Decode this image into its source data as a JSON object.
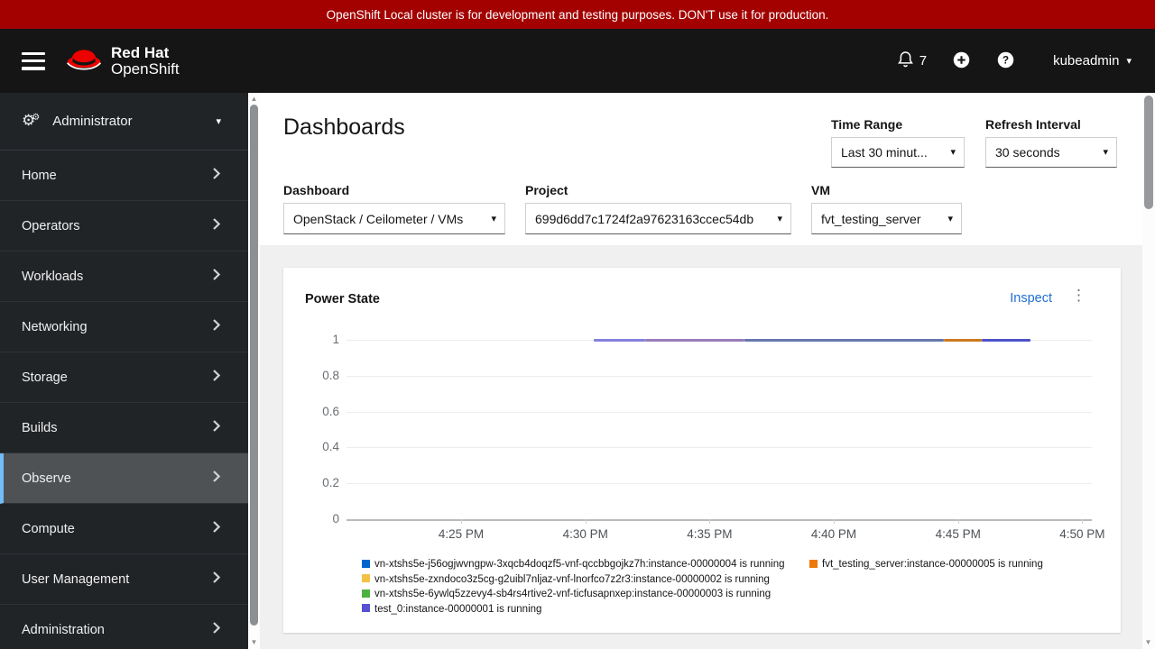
{
  "banner": {
    "text": "OpenShift Local cluster is for development and testing purposes. DON'T use it for production.",
    "background_color": "#a30000"
  },
  "masthead": {
    "brand_line1": "Red Hat",
    "brand_line2": "OpenShift",
    "notification_count": "7",
    "username": "kubeadmin"
  },
  "sidebar": {
    "perspective": "Administrator",
    "active_item_color": "#73bcf7",
    "items": [
      {
        "label": "Home",
        "active": false
      },
      {
        "label": "Operators",
        "active": false
      },
      {
        "label": "Workloads",
        "active": false
      },
      {
        "label": "Networking",
        "active": false
      },
      {
        "label": "Storage",
        "active": false
      },
      {
        "label": "Builds",
        "active": false
      },
      {
        "label": "Observe",
        "active": true
      },
      {
        "label": "Compute",
        "active": false
      },
      {
        "label": "User Management",
        "active": false
      },
      {
        "label": "Administration",
        "active": false
      }
    ]
  },
  "page": {
    "title": "Dashboards",
    "filters": {
      "time_range": {
        "label": "Time Range",
        "value": "Last 30 minut..."
      },
      "refresh": {
        "label": "Refresh Interval",
        "value": "30 seconds"
      },
      "dashboard": {
        "label": "Dashboard",
        "value": "OpenStack / Ceilometer / VMs"
      },
      "project": {
        "label": "Project",
        "value": "699d6dd7c1724f2a97623163ccec54db"
      },
      "vm": {
        "label": "VM",
        "value": "fvt_testing_server"
      }
    }
  },
  "card": {
    "title": "Power State",
    "inspect_label": "Inspect",
    "link_color": "#1f6ed4"
  },
  "chart_data": {
    "type": "line",
    "title": "Power State",
    "ylim": [
      0,
      1
    ],
    "y_ticks": [
      "1",
      "0.8",
      "0.6",
      "0.4",
      "0.2",
      "0"
    ],
    "x_ticks": [
      "4:25 PM",
      "4:30 PM",
      "4:35 PM",
      "4:40 PM",
      "4:45 PM",
      "4:50 PM"
    ],
    "x_domain": [
      "4:20 PM",
      "4:50 PM"
    ],
    "grid": true,
    "legend_position": "bottom",
    "series": [
      {
        "label": "vn-xtshs5e-j56ogjwvngpw-3xqcb4doqzf5-vnf-qccbbgojkz7h:instance-00000004 is running",
        "color": "#0066cc",
        "value": 1,
        "approx_start": "4:30 PM",
        "approx_end": "4:48 PM"
      },
      {
        "label": "fvt_testing_server:instance-00000005 is running",
        "color": "#ec7a08",
        "value": 1,
        "approx_start": "4:44 PM",
        "approx_end": "4:46 PM"
      },
      {
        "label": "vn-xtshs5e-zxndoco3z5cg-g2uibl7nljaz-vnf-lnorfco7z2r3:instance-00000002 is running",
        "color": "#f4c145",
        "value": 1,
        "approx_start": "4:30 PM",
        "approx_end": "4:48 PM"
      },
      {
        "label": "vn-xtshs5e-6ywlq5zzevy4-sb4rs4rtive2-vnf-ticfusapnxep:instance-00000003 is running",
        "color": "#4cb140",
        "value": 1,
        "approx_start": "4:30 PM",
        "approx_end": "4:48 PM"
      },
      {
        "label": "test_0:instance-00000001 is running",
        "color": "#5752d1",
        "value": 1,
        "approx_start": "4:30 PM",
        "approx_end": "4:48 PM"
      }
    ],
    "legend_columns": [
      [
        0,
        2,
        3,
        4
      ],
      [
        1
      ]
    ],
    "rendered_line": {
      "value": 1,
      "segments": [
        {
          "from": 0.332,
          "to": 0.401,
          "color": "#8481dd"
        },
        {
          "from": 0.401,
          "to": 0.534,
          "color": "#997cba"
        },
        {
          "from": 0.534,
          "to": 0.801,
          "color": "#6677ab"
        },
        {
          "from": 0.801,
          "to": 0.852,
          "color": "#cb7a1f"
        },
        {
          "from": 0.852,
          "to": 0.918,
          "color": "#4d52c8"
        }
      ]
    }
  },
  "icons": {
    "caret_down": "▾",
    "kebab": "⋮",
    "up_arrow": "▲",
    "down_arrow": "▼",
    "cog": "⚙"
  }
}
